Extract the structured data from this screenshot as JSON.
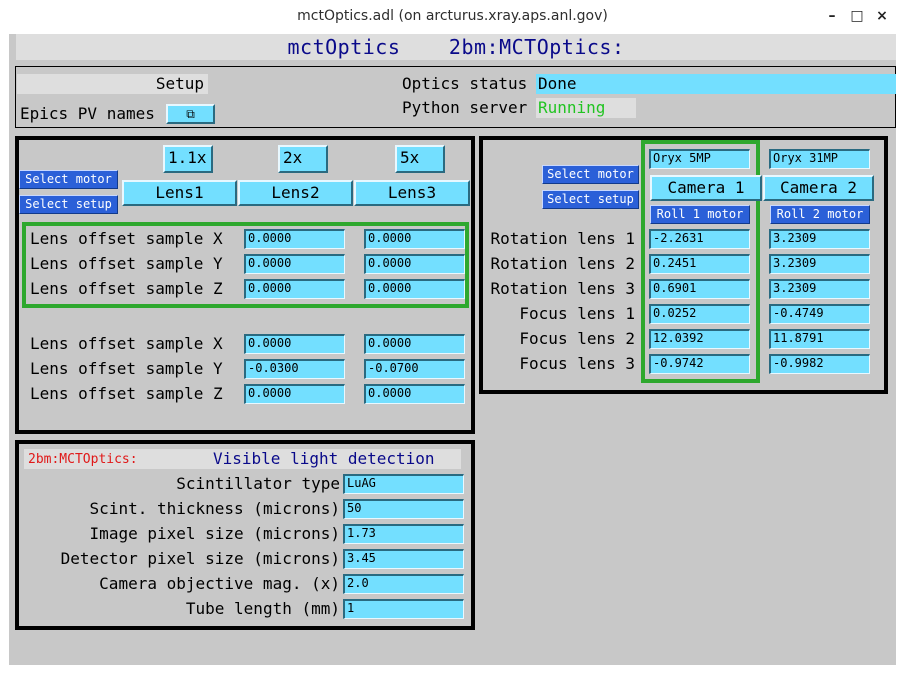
{
  "window": {
    "title": "mctOptics.adl (on arcturus.xray.aps.anl.gov)",
    "minimize": "–",
    "maximize": "□",
    "close": "×"
  },
  "header": {
    "title": "mctOptics",
    "prefix": "2bm:MCTOptics:"
  },
  "setup": {
    "setup_label": "Setup",
    "epics_label": "Epics PV names",
    "epics_button_icon": "⧉",
    "optics_status_label": "Optics status",
    "optics_status_value": "Done",
    "python_server_label": "Python server",
    "python_server_value": "Running"
  },
  "lenses": {
    "mags": [
      "1.1x",
      "2x",
      "5x"
    ],
    "names": [
      "Lens1",
      "Lens2",
      "Lens3"
    ],
    "select_motor": "Select motor",
    "select_setup": "Select setup",
    "rows_top": [
      {
        "label": "Lens offset sample X",
        "v1": "0.0000",
        "v2": "0.0000"
      },
      {
        "label": "Lens offset sample Y",
        "v1": "0.0000",
        "v2": "0.0000"
      },
      {
        "label": "Lens offset sample Z",
        "v1": "0.0000",
        "v2": "0.0000"
      }
    ],
    "rows_bottom": [
      {
        "label": "Lens offset sample X",
        "v1": "0.0000",
        "v2": "0.0000"
      },
      {
        "label": "Lens offset sample Y",
        "v1": "-0.0300",
        "v2": "-0.0700"
      },
      {
        "label": "Lens offset sample Z",
        "v1": "0.0000",
        "v2": "0.0000"
      }
    ]
  },
  "cameras": {
    "select_motor": "Select motor",
    "select_setup": "Select setup",
    "models": [
      "Oryx 5MP",
      "Oryx 31MP"
    ],
    "names": [
      "Camera 1",
      "Camera 2"
    ],
    "roll_buttons": [
      "Roll 1 motor",
      "Roll 2 motor"
    ],
    "rows": [
      {
        "label": "Rotation lens 1",
        "c1": "-2.2631",
        "c2": "3.2309"
      },
      {
        "label": "Rotation lens 2",
        "c1": "0.2451",
        "c2": "3.2309"
      },
      {
        "label": "Rotation lens 3",
        "c1": "0.6901",
        "c2": "3.2309"
      },
      {
        "label": "Focus lens 1",
        "c1": "0.0252",
        "c2": "-0.4749"
      },
      {
        "label": "Focus lens 2",
        "c1": "12.0392",
        "c2": "11.8791"
      },
      {
        "label": "Focus lens 3",
        "c1": "-0.9742",
        "c2": "-0.9982"
      }
    ]
  },
  "detection": {
    "prefix": "2bm:MCTOptics:",
    "title": "Visible light detection",
    "rows": [
      {
        "label": "Scintillator type",
        "value": "LuAG"
      },
      {
        "label": "Scint. thickness (microns)",
        "value": "50"
      },
      {
        "label": "Image pixel size (microns)",
        "value": "1.73"
      },
      {
        "label": "Detector pixel size (microns)",
        "value": "3.45"
      },
      {
        "label": "Camera objective mag. (x)",
        "value": "2.0"
      },
      {
        "label": "Tube length (mm)",
        "value": "1"
      }
    ]
  }
}
